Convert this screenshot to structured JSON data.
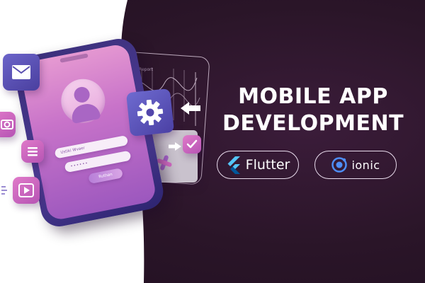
{
  "heading": {
    "line1": "MOBILE APP",
    "line2": "DEVELOPMENT"
  },
  "tech_badges": [
    {
      "label": "Flutter",
      "icon": "flutter-logo-icon"
    },
    {
      "label": "ionic",
      "icon": "ionic-logo-icon"
    }
  ],
  "phone": {
    "username_placeholder": "Ustiki Wvaer",
    "password_value": "••••••",
    "submit_label": "Ruthan"
  },
  "wire_screen": {
    "title": "Daily Report"
  },
  "icons": [
    "mail-icon",
    "camera-icon",
    "menu-list-icon",
    "play-icon",
    "gear-icon",
    "checkmark-icon",
    "avatar-icon",
    "arrow-left-icon",
    "arrow-right-icon",
    "cross-icon"
  ],
  "colors": {
    "background": "#2a1528",
    "accent_pink": "#d36bc4",
    "accent_purple": "#5b4fb8",
    "white": "#ffffff"
  }
}
